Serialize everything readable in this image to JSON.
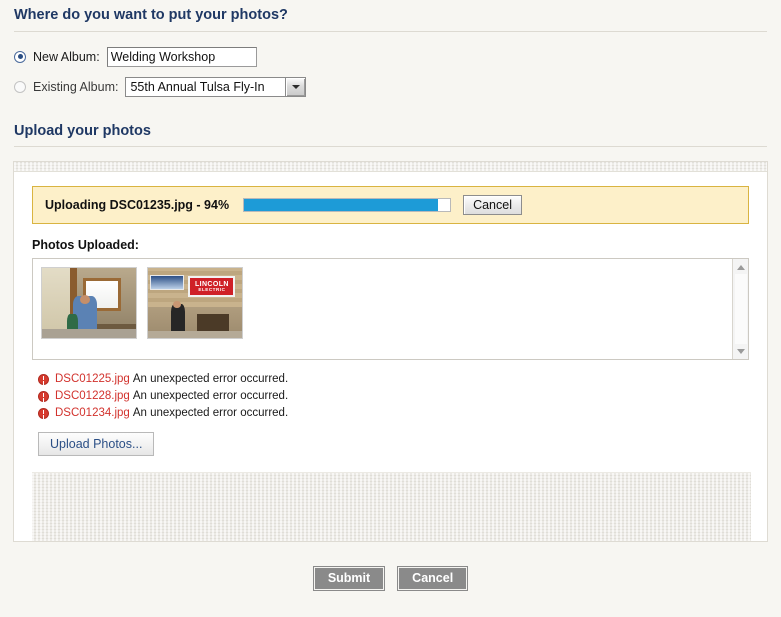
{
  "destination": {
    "heading": "Where do you want to put your photos?",
    "new_album": {
      "label": "New Album:",
      "selected": true,
      "value": "Welding Workshop",
      "placeholder": ""
    },
    "existing_album": {
      "label": "Existing Album:",
      "selected": false,
      "value": "55th Annual Tulsa Fly-In",
      "options": [
        "55th Annual Tulsa Fly-In"
      ]
    }
  },
  "upload": {
    "heading": "Upload your photos",
    "progress": {
      "text": "Uploading DSC01235.jpg - 94%",
      "file": "DSC01235.jpg",
      "percent": 94,
      "cancel_label": "Cancel",
      "bar_color": "#1d9bd7",
      "strip_bg": "#fdf0c9",
      "strip_border": "#d9b441"
    },
    "photos_uploaded": {
      "label": "Photos Uploaded:",
      "thumbnails": [
        {
          "name": "thumbnail-1",
          "alt": "Man standing in workshop beside bright window"
        },
        {
          "name": "thumbnail-2",
          "alt": "Person under Lincoln Electric banner in workshop",
          "sign_line1": "LINCOLN",
          "sign_line2": "ELECTRIC"
        }
      ],
      "scrollbar": {
        "up": "scroll-up-arrow",
        "down": "scroll-down-arrow"
      }
    },
    "errors": [
      {
        "file": "DSC01225.jpg",
        "separator": ":",
        "message": "An unexpected error occurred."
      },
      {
        "file": "DSC01228.jpg",
        "separator": ":",
        "message": "An unexpected error occurred."
      },
      {
        "file": "DSC01234.jpg",
        "separator": ":",
        "message": "An unexpected error occurred."
      }
    ],
    "error_color": "#d2322d",
    "upload_button_label": "Upload Photos..."
  },
  "footer": {
    "submit_label": "Submit",
    "cancel_label": "Cancel",
    "button_color": "#8a8a8a"
  }
}
